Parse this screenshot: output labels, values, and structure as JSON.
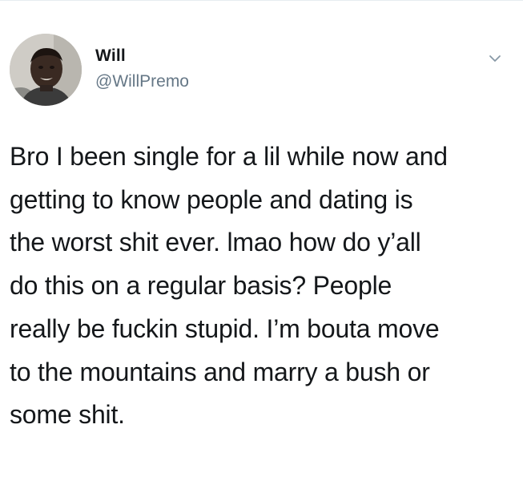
{
  "tweet": {
    "author": {
      "name": "Will",
      "handle": "@WillPremo",
      "avatar_icon": "profile-photo"
    },
    "menu_icon": "chevron-down-icon",
    "text": "Bro I been single for a lil while now and\ngetting to know people and dating is\nthe worst shit ever. lmao how do y’all\ndo this on a regular basis? People\nreally be fuckin stupid. I’m bouta move\nto the mountains and marry a bush or\nsome shit."
  },
  "colors": {
    "text": "#14171a",
    "secondary": "#657786",
    "divider": "#e6ecf0"
  }
}
